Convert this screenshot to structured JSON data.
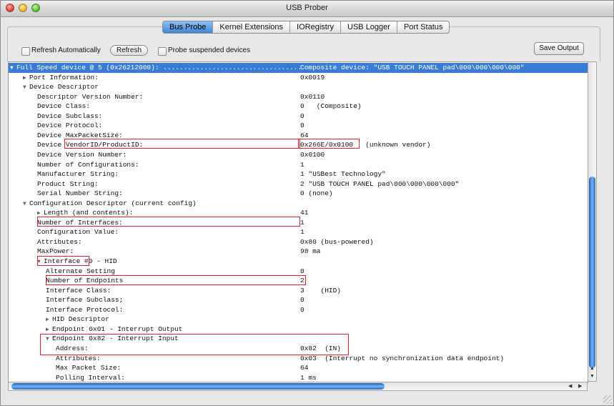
{
  "window": {
    "title": "USB Prober"
  },
  "tabs": [
    {
      "label": "Bus Probe",
      "active": true
    },
    {
      "label": "Kernel Extensions",
      "active": false
    },
    {
      "label": "IORegistry",
      "active": false
    },
    {
      "label": "USB Logger",
      "active": false
    },
    {
      "label": "Port Status",
      "active": false
    }
  ],
  "toolbar": {
    "refresh_auto_label": "Refresh Automatically",
    "refresh_label": "Refresh",
    "probe_label": "Probe suspended devices",
    "save_label": "Save Output"
  },
  "rows": [
    {
      "label": "Full Speed device @ 5 (0x26212000): ..................................",
      "value": "Composite device: \"USB TOUCH PANEL pad\\000\\000\\000\\000\"",
      "selected": true,
      "indent": 0,
      "disclosure": "open"
    },
    {
      "label": "Port Information:",
      "value": "0x0019",
      "indent": 1,
      "disclosure": "closed"
    },
    {
      "label": "Device Descriptor",
      "value": "",
      "indent": 1,
      "disclosure": "open"
    },
    {
      "label": "Descriptor Version Number:",
      "value": "0x0110",
      "indent": 2
    },
    {
      "label": "Device Class:",
      "value": "0   (Composite)",
      "indent": 2
    },
    {
      "label": "Device Subclass:",
      "value": "0",
      "indent": 2
    },
    {
      "label": "Device Protocol:",
      "value": "0",
      "indent": 2
    },
    {
      "label": "Device MaxPacketSize:",
      "value": "64",
      "indent": 2
    },
    {
      "label": "Device VendorID/ProductID:",
      "value": "0x266E/0x0100   (unknown vendor)",
      "indent": 2
    },
    {
      "label": "Device Version Number:",
      "value": "0x0100",
      "indent": 2
    },
    {
      "label": "Number of Configurations:",
      "value": "1",
      "indent": 2
    },
    {
      "label": "Manufacturer String:",
      "value": "1 \"USBest Technology\"",
      "indent": 2
    },
    {
      "label": "Product String:",
      "value": "2 \"USB TOUCH PANEL pad\\000\\000\\000\\000\"",
      "indent": 2
    },
    {
      "label": "Serial Number String:",
      "value": "0 (none)",
      "indent": 2
    },
    {
      "label": "Configuration Descriptor (current config)",
      "value": "",
      "indent": 1,
      "disclosure": "open"
    },
    {
      "label": "Length (and contents):",
      "value": "41",
      "indent": 2,
      "disclosure": "closed"
    },
    {
      "label": "Number of Interfaces:",
      "value": "1",
      "indent": 2
    },
    {
      "label": "Configuration Value:",
      "value": "1",
      "indent": 2
    },
    {
      "label": "Attributes:",
      "value": "0x80 (bus-powered)",
      "indent": 2
    },
    {
      "label": "MaxPower:",
      "value": "98 ma",
      "indent": 2
    },
    {
      "label": "Interface #0 - HID",
      "value": "",
      "indent": 2,
      "disclosure": "open"
    },
    {
      "label": "Alternate Setting",
      "value": "0",
      "indent": 3
    },
    {
      "label": "Number of Endpoints",
      "value": "2",
      "indent": 3
    },
    {
      "label": "Interface Class:",
      "value": "3    (HID)",
      "indent": 3
    },
    {
      "label": "Interface Subclass;",
      "value": "0",
      "indent": 3
    },
    {
      "label": "Interface Protocol:",
      "value": "0",
      "indent": 3
    },
    {
      "label": "HID Descriptor",
      "value": "",
      "indent": 3,
      "disclosure": "closed"
    },
    {
      "label": "Endpoint 0x01 - Interrupt Output",
      "value": "",
      "indent": 3,
      "disclosure": "closed"
    },
    {
      "label": "Endpoint 0x82 - Interrupt Input",
      "value": "",
      "indent": 3,
      "disclosure": "open"
    },
    {
      "label": "Address:",
      "value": "0x82  (IN)",
      "indent": 4
    },
    {
      "label": "Attributes:",
      "value": "0x03  (Interrupt no synchronization data endpoint)",
      "indent": 4
    },
    {
      "label": "Max Packet Size:",
      "value": "64",
      "indent": 4
    },
    {
      "label": "Polling Interval:",
      "value": "1 ms",
      "indent": 4
    }
  ],
  "colors": {
    "selection": "#3a7bd5",
    "highlight_box": "#d4272b"
  }
}
